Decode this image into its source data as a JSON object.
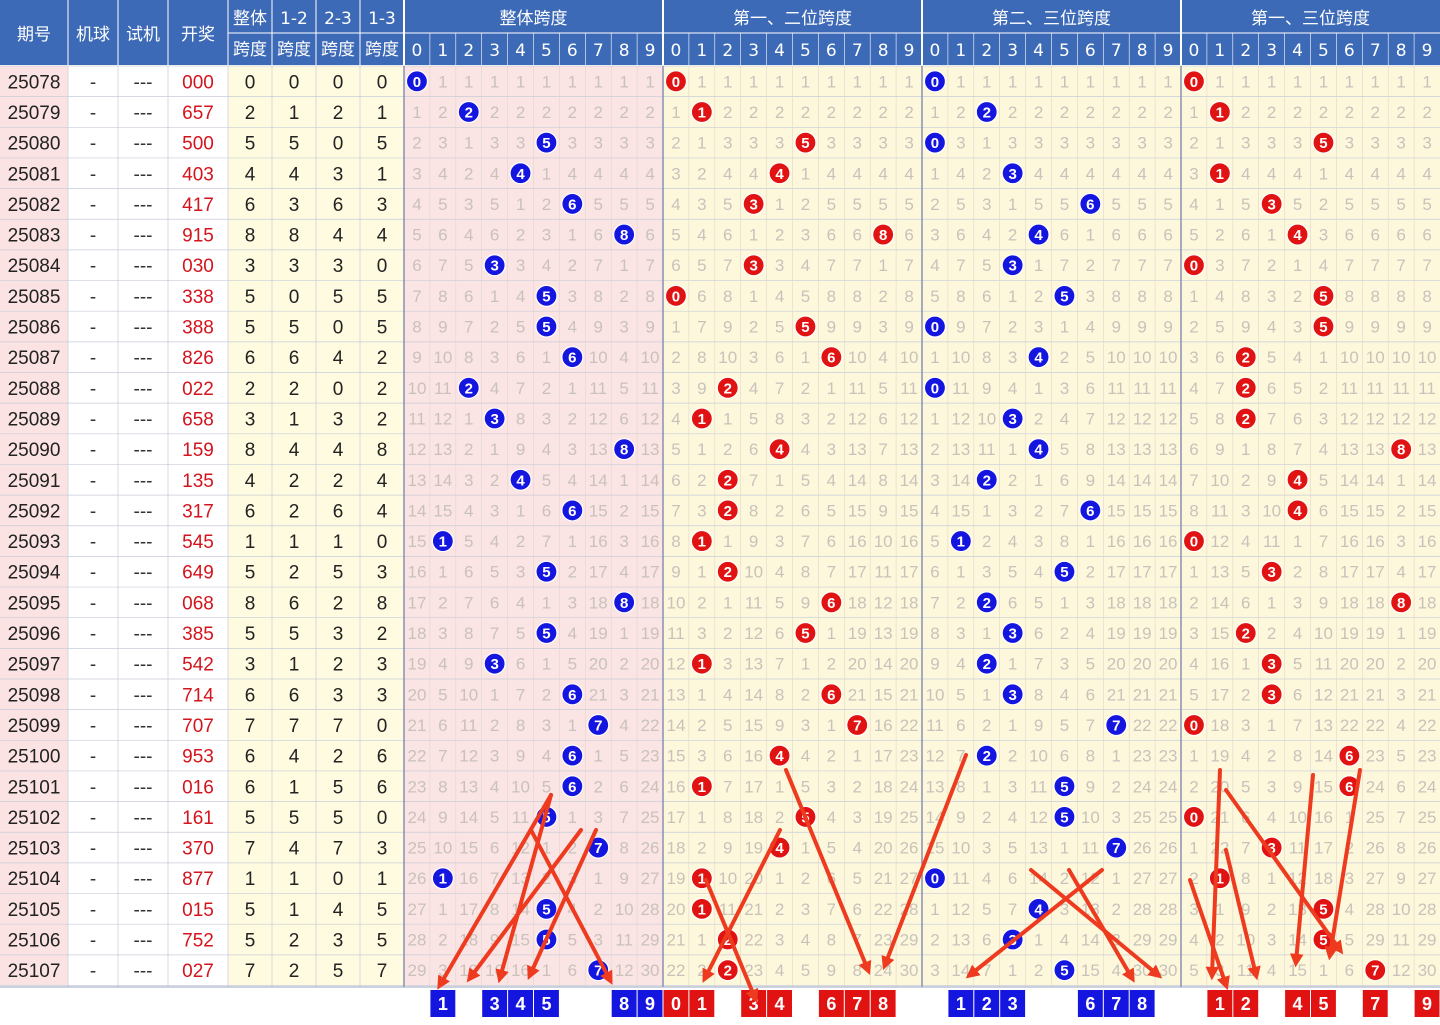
{
  "columns": {
    "issue": "期号",
    "machine": "机球",
    "trial": "试机",
    "draw": "开奖",
    "span_all": [
      "整体",
      "跨度"
    ],
    "span_12": [
      "1-2",
      "跨度"
    ],
    "span_23": [
      "2-3",
      "跨度"
    ],
    "span_13": [
      "1-3",
      "跨度"
    ]
  },
  "groups": [
    {
      "title": "整体跨度",
      "color": "#1515e0"
    },
    {
      "title": "第一、二位跨度",
      "color": "#e01212"
    },
    {
      "title": "第二、三位跨度",
      "color": "#1515e0"
    },
    {
      "title": "第一、三位跨度",
      "color": "#e01212"
    }
  ],
  "digits": [
    "0",
    "1",
    "2",
    "3",
    "4",
    "5",
    "6",
    "7",
    "8",
    "9"
  ],
  "colors": {
    "header": "#3d6ab7",
    "issue_bg": "#fbe3e3",
    "draw_text": "#d4141c",
    "span_bg": "#fffbe0",
    "blue_ball": "#1515e0",
    "red_ball": "#e01212",
    "arrow": "#ee3a1e"
  },
  "chart_data": {
    "type": "table",
    "rows": [
      {
        "issue": "25078",
        "machine": "-",
        "trial": "---",
        "draw": "000",
        "spans": [
          0,
          0,
          0,
          0
        ]
      },
      {
        "issue": "25079",
        "machine": "-",
        "trial": "---",
        "draw": "657",
        "spans": [
          2,
          1,
          2,
          1
        ]
      },
      {
        "issue": "25080",
        "machine": "-",
        "trial": "---",
        "draw": "500",
        "spans": [
          5,
          5,
          0,
          5
        ]
      },
      {
        "issue": "25081",
        "machine": "-",
        "trial": "---",
        "draw": "403",
        "spans": [
          4,
          4,
          3,
          1
        ]
      },
      {
        "issue": "25082",
        "machine": "-",
        "trial": "---",
        "draw": "417",
        "spans": [
          6,
          3,
          6,
          3
        ]
      },
      {
        "issue": "25083",
        "machine": "-",
        "trial": "---",
        "draw": "915",
        "spans": [
          8,
          8,
          4,
          4
        ]
      },
      {
        "issue": "25084",
        "machine": "-",
        "trial": "---",
        "draw": "030",
        "spans": [
          3,
          3,
          3,
          0
        ]
      },
      {
        "issue": "25085",
        "machine": "-",
        "trial": "---",
        "draw": "338",
        "spans": [
          5,
          0,
          5,
          5
        ]
      },
      {
        "issue": "25086",
        "machine": "-",
        "trial": "---",
        "draw": "388",
        "spans": [
          5,
          5,
          0,
          5
        ]
      },
      {
        "issue": "25087",
        "machine": "-",
        "trial": "---",
        "draw": "826",
        "spans": [
          6,
          6,
          4,
          2
        ]
      },
      {
        "issue": "25088",
        "machine": "-",
        "trial": "---",
        "draw": "022",
        "spans": [
          2,
          2,
          0,
          2
        ]
      },
      {
        "issue": "25089",
        "machine": "-",
        "trial": "---",
        "draw": "658",
        "spans": [
          3,
          1,
          3,
          2
        ]
      },
      {
        "issue": "25090",
        "machine": "-",
        "trial": "---",
        "draw": "159",
        "spans": [
          8,
          4,
          4,
          8
        ]
      },
      {
        "issue": "25091",
        "machine": "-",
        "trial": "---",
        "draw": "135",
        "spans": [
          4,
          2,
          2,
          4
        ]
      },
      {
        "issue": "25092",
        "machine": "-",
        "trial": "---",
        "draw": "317",
        "spans": [
          6,
          2,
          6,
          4
        ]
      },
      {
        "issue": "25093",
        "machine": "-",
        "trial": "---",
        "draw": "545",
        "spans": [
          1,
          1,
          1,
          0
        ]
      },
      {
        "issue": "25094",
        "machine": "-",
        "trial": "---",
        "draw": "649",
        "spans": [
          5,
          2,
          5,
          3
        ]
      },
      {
        "issue": "25095",
        "machine": "-",
        "trial": "---",
        "draw": "068",
        "spans": [
          8,
          6,
          2,
          8
        ]
      },
      {
        "issue": "25096",
        "machine": "-",
        "trial": "---",
        "draw": "385",
        "spans": [
          5,
          5,
          3,
          2
        ]
      },
      {
        "issue": "25097",
        "machine": "-",
        "trial": "---",
        "draw": "542",
        "spans": [
          3,
          1,
          2,
          3
        ]
      },
      {
        "issue": "25098",
        "machine": "-",
        "trial": "---",
        "draw": "714",
        "spans": [
          6,
          6,
          3,
          3
        ]
      },
      {
        "issue": "25099",
        "machine": "-",
        "trial": "---",
        "draw": "707",
        "spans": [
          7,
          7,
          7,
          0
        ]
      },
      {
        "issue": "25100",
        "machine": "-",
        "trial": "---",
        "draw": "953",
        "spans": [
          6,
          4,
          2,
          6
        ]
      },
      {
        "issue": "25101",
        "machine": "-",
        "trial": "---",
        "draw": "016",
        "spans": [
          6,
          1,
          5,
          6
        ]
      },
      {
        "issue": "25102",
        "machine": "-",
        "trial": "---",
        "draw": "161",
        "spans": [
          5,
          5,
          5,
          0
        ]
      },
      {
        "issue": "25103",
        "machine": "-",
        "trial": "---",
        "draw": "370",
        "spans": [
          7,
          4,
          7,
          3
        ]
      },
      {
        "issue": "25104",
        "machine": "-",
        "trial": "---",
        "draw": "877",
        "spans": [
          1,
          1,
          0,
          1
        ]
      },
      {
        "issue": "25105",
        "machine": "-",
        "trial": "---",
        "draw": "015",
        "spans": [
          5,
          1,
          4,
          5
        ]
      },
      {
        "issue": "25106",
        "machine": "-",
        "trial": "---",
        "draw": "752",
        "spans": [
          5,
          2,
          3,
          5
        ]
      },
      {
        "issue": "25107",
        "machine": "-",
        "trial": "---",
        "draw": "027",
        "spans": [
          7,
          2,
          5,
          7
        ]
      }
    ],
    "prediction": [
      [
        "1",
        "3",
        "4",
        "5",
        "8",
        "9"
      ],
      [
        "0",
        "1",
        "3",
        "4",
        "6",
        "7",
        "8"
      ],
      [
        "1",
        "2",
        "3",
        "6",
        "7",
        "8"
      ],
      [
        "1",
        "2",
        "4",
        "5",
        "7",
        "9"
      ]
    ]
  }
}
